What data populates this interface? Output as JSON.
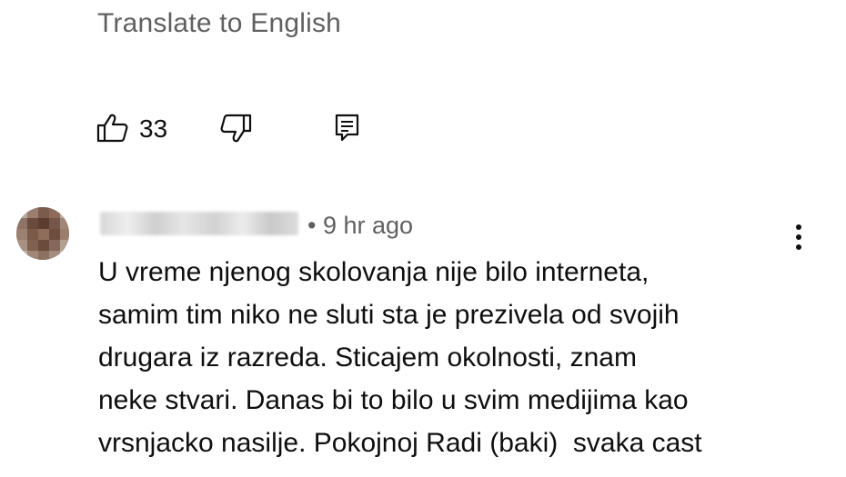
{
  "comment_prev": {
    "translate_label": "Translate to English",
    "like_count": "33",
    "icons": {
      "like": "thumbs-up-icon",
      "dislike": "thumbs-down-icon",
      "reply": "reply-icon"
    }
  },
  "comment": {
    "timestamp": "• 9 hr ago",
    "lines": [
      "U vreme njenog skolovanja nije bilo interneta,",
      "samim tim niko ne sluti sta je prezivela od svojih",
      "drugara iz razreda. Sticajem okolnosti, znam",
      "neke stvari. Danas bi to bilo u svim medijima kao",
      "vrsnjacko nasilje. Pokojnoj Radi (baki)  svaka cast"
    ],
    "icons": {
      "more": "more-vert-icon"
    }
  },
  "colors": {
    "text_primary": "#0f0f0f",
    "text_secondary": "#606060",
    "background": "#ffffff"
  }
}
